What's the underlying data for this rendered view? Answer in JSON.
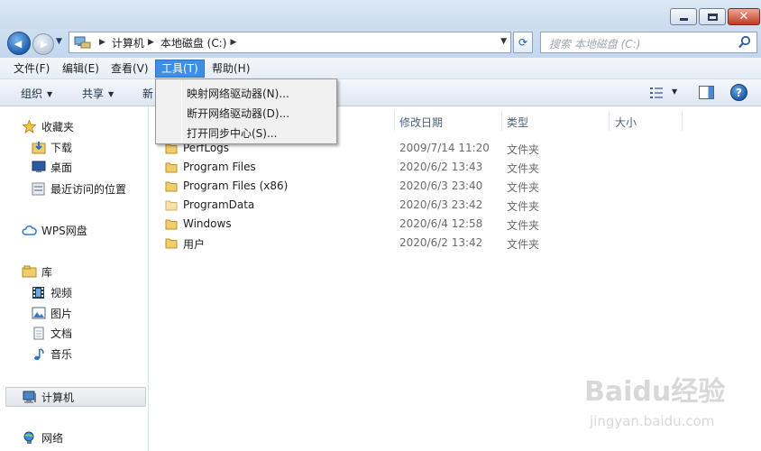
{
  "titlebar": {
    "close_glyph": "✕"
  },
  "nav": {
    "back_glyph": "◀",
    "forward_glyph": "▶",
    "breadcrumbs": [
      "计算机",
      "本地磁盘 (C:)"
    ],
    "refresh_glyph": "⟳",
    "search_placeholder": "搜索 本地磁盘 (C:)"
  },
  "menubar": {
    "items": [
      "文件(F)",
      "编辑(E)",
      "查看(V)",
      "工具(T)",
      "帮助(H)"
    ],
    "active": "工具(T)"
  },
  "toolbar": {
    "organize": "组织",
    "share": "共享",
    "new_partial": "新",
    "help_glyph": "?"
  },
  "tools_menu": {
    "items": [
      "映射网络驱动器(N)...",
      "断开网络驱动器(D)...",
      "打开同步中心(S)..."
    ]
  },
  "navpane": {
    "favorites": "收藏夹",
    "favorites_items": [
      "下载",
      "桌面",
      "最近访问的位置"
    ],
    "wps": "WPS网盘",
    "libraries": "库",
    "libraries_items": [
      "视频",
      "图片",
      "文档",
      "音乐"
    ],
    "computer": "计算机",
    "network": "网络"
  },
  "filelist": {
    "columns": [
      "修改日期",
      "类型",
      "大小"
    ],
    "rows": [
      {
        "name": "PerfLogs",
        "date": "2009/7/14 11:20",
        "type": "文件夹"
      },
      {
        "name": "Program Files",
        "date": "2020/6/2 13:43",
        "type": "文件夹"
      },
      {
        "name": "Program Files (x86)",
        "date": "2020/6/3 23:40",
        "type": "文件夹"
      },
      {
        "name": "ProgramData",
        "date": "2020/6/3 23:42",
        "type": "文件夹"
      },
      {
        "name": "Windows",
        "date": "2020/6/4 12:58",
        "type": "文件夹"
      },
      {
        "name": "用户",
        "date": "2020/6/2 13:42",
        "type": "文件夹"
      }
    ]
  },
  "watermark": {
    "logo_text": "Baidu经验",
    "url": "jingyan.baidu.com"
  }
}
